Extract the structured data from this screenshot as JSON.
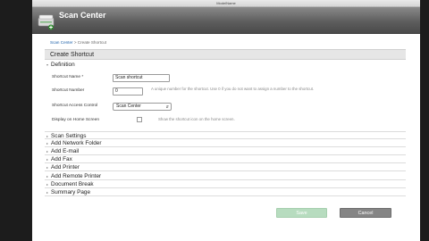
{
  "window": {
    "title": "ModelName"
  },
  "header": {
    "app_title": "Scan Center"
  },
  "breadcrumb": {
    "link": "Scan Center",
    "separator": " > ",
    "current": "Create Shortcut"
  },
  "panel": {
    "title": "Create Shortcut"
  },
  "definition": {
    "title": "Definition",
    "shortcut_name_label": "Shortcut Name *",
    "shortcut_name_value": "Scan shortcut",
    "shortcut_number_label": "Shortcut Number",
    "shortcut_number_value": "0",
    "shortcut_number_hint": "A unique number for the shortcut. Use 0 if you do not want to assign a number to the shortcut.",
    "access_control_label": "Shortcut Access Control",
    "access_control_value": "Scan Center",
    "display_home_label": "Display on Home Screen",
    "display_home_hint": "Show the shortcut icon on the home screen."
  },
  "sections": [
    "Scan Settings",
    "Add Network Folder",
    "Add E-mail",
    "Add Fax",
    "Add Printer",
    "Add Remote Printer",
    "Document Break",
    "Summary Page"
  ],
  "buttons": {
    "save": "Save",
    "cancel": "Cancel"
  },
  "colors": {
    "header": "#5e5e5e",
    "save": "#b7dcbf",
    "cancel": "#858585"
  }
}
